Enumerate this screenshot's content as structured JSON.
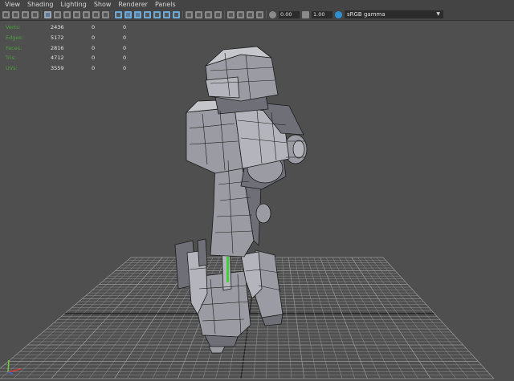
{
  "menubar": {
    "items": [
      "View",
      "Shading",
      "Lighting",
      "Show",
      "Renderer",
      "Panels"
    ]
  },
  "toolbar": {
    "exposure_value": "0.00",
    "gamma_value": "1.00",
    "color_space": "sRGB gamma",
    "icons": [
      {
        "name": "select-camera-icon",
        "color": "#8a8a8a"
      },
      {
        "name": "camera-attributes-icon",
        "color": "#8a8a8a"
      },
      {
        "name": "bookmark-icon",
        "color": "#8a8a8a"
      },
      {
        "name": "image-plane-icon",
        "color": "#8a8a8a"
      },
      {
        "name": "grid-icon",
        "color": "#9aa4b0",
        "active": true
      },
      {
        "name": "film-gate-icon",
        "color": "#8a8a8a"
      },
      {
        "name": "resolution-gate-icon",
        "color": "#8a8a8a"
      },
      {
        "name": "gate-mask-icon",
        "color": "#8a8a8a"
      },
      {
        "name": "field-chart-icon",
        "color": "#8a8a8a"
      },
      {
        "name": "safe-action-icon",
        "color": "#8a8a8a"
      },
      {
        "name": "safe-title-icon",
        "color": "#8a8a8a"
      },
      {
        "name": "wireframe-icon",
        "color": "#6aa9d8"
      },
      {
        "name": "smooth-shade-icon",
        "color": "#6aa9d8",
        "active": true
      },
      {
        "name": "wireframe-on-shaded-icon",
        "color": "#6aa9d8",
        "active": true
      },
      {
        "name": "default-material-icon",
        "color": "#6aa9d8"
      },
      {
        "name": "textured-icon",
        "color": "#6aa9d8"
      },
      {
        "name": "use-all-lights-icon",
        "color": "#6aa9d8"
      },
      {
        "name": "shadows-icon",
        "color": "#6aa9d8"
      },
      {
        "name": "screen-space-ao-icon",
        "color": "#8a8a8a"
      },
      {
        "name": "motion-blur-icon",
        "color": "#8a8a8a"
      },
      {
        "name": "multisample-aa-icon",
        "color": "#8a8a8a"
      },
      {
        "name": "depth-of-field-icon",
        "color": "#8a8a8a"
      },
      {
        "name": "isolate-select-icon",
        "color": "#8a8a8a"
      },
      {
        "name": "xray-icon",
        "color": "#8a8a8a"
      },
      {
        "name": "xray-joints-icon",
        "color": "#8a8a8a"
      },
      {
        "name": "xray-components-icon",
        "color": "#8a8a8a"
      }
    ]
  },
  "hud": {
    "rows": [
      {
        "label": "Verts:",
        "values": [
          "2436",
          "0",
          "0"
        ]
      },
      {
        "label": "Edges:",
        "values": [
          "5172",
          "0",
          "0"
        ]
      },
      {
        "label": "Faces:",
        "values": [
          "2816",
          "0",
          "0"
        ]
      },
      {
        "label": "Tris:",
        "values": [
          "4712",
          "0",
          "0"
        ]
      },
      {
        "label": "UVs:",
        "values": [
          "3559",
          "0",
          "0"
        ]
      }
    ]
  },
  "colors": {
    "viewport_bg": "#4f4f4f",
    "grid_line": "#9a9a9a",
    "grid_axis": "#1e1e1e",
    "model_fill": "#9b9ba3",
    "model_shadow": "#6f6f78",
    "wire": "#1a1a1a",
    "hud_label": "#49a33b"
  }
}
